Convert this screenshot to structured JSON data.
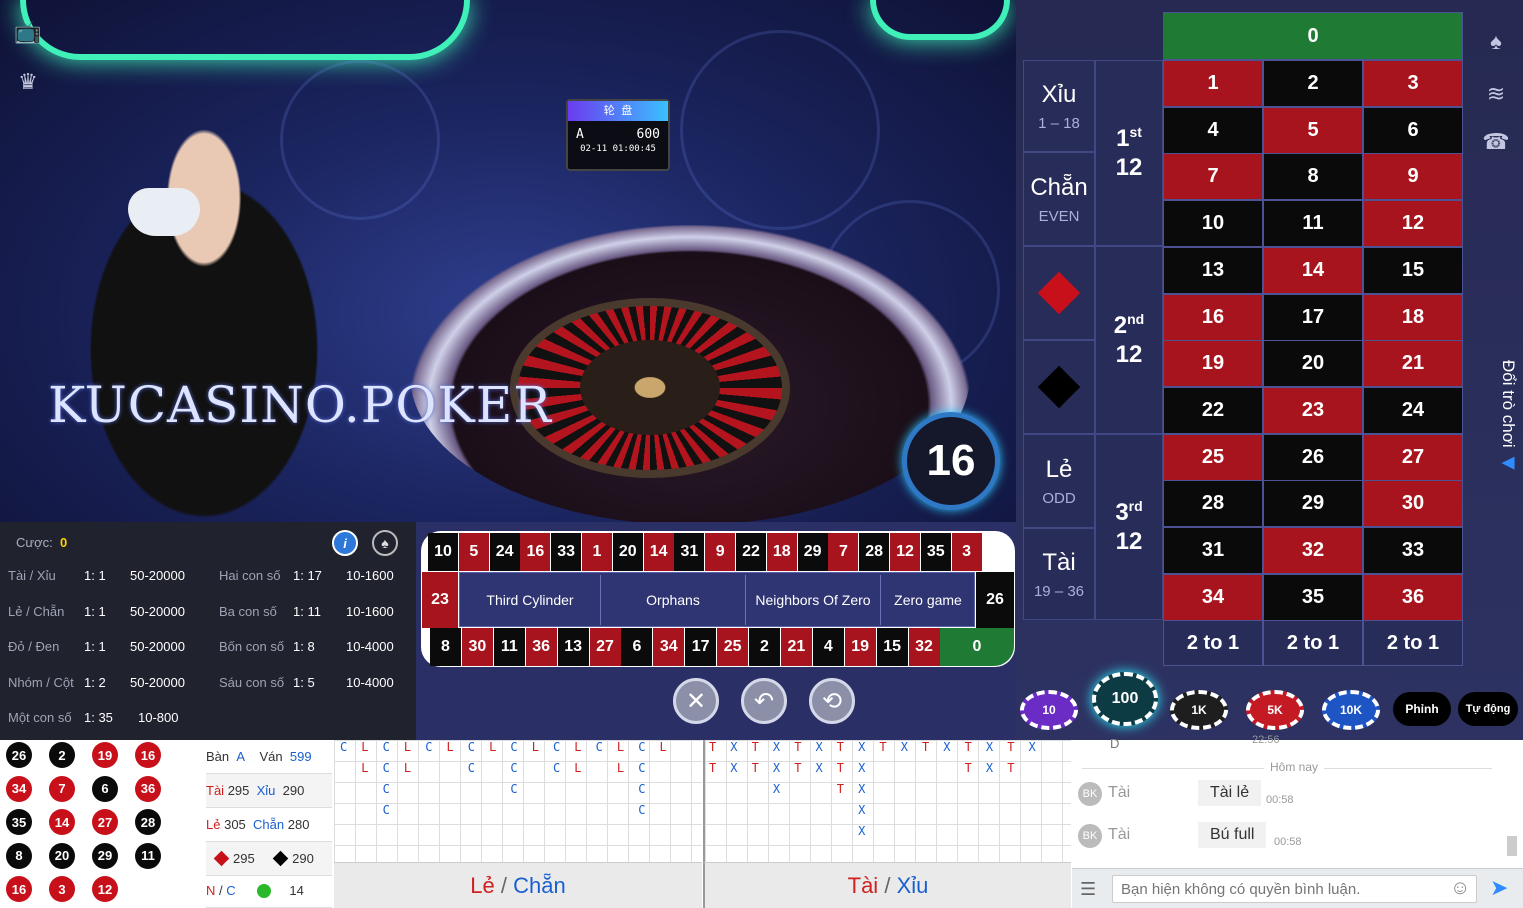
{
  "video": {
    "screen_symbols": "轮 盘",
    "screen_round": "A",
    "screen_value": "600",
    "screen_time": "02-11 01:00:45",
    "watermark": "KUCASINO.POKER",
    "result": "16",
    "left_icons": [
      "tv-icon",
      "crown-icon"
    ]
  },
  "board": {
    "zero": "0",
    "rows": [
      [
        {
          "n": "1",
          "c": "red"
        },
        {
          "n": "2",
          "c": "blk"
        },
        {
          "n": "3",
          "c": "red"
        }
      ],
      [
        {
          "n": "4",
          "c": "blk"
        },
        {
          "n": "5",
          "c": "red"
        },
        {
          "n": "6",
          "c": "blk"
        }
      ],
      [
        {
          "n": "7",
          "c": "red"
        },
        {
          "n": "8",
          "c": "blk"
        },
        {
          "n": "9",
          "c": "red"
        }
      ],
      [
        {
          "n": "10",
          "c": "blk"
        },
        {
          "n": "11",
          "c": "blk"
        },
        {
          "n": "12",
          "c": "red"
        }
      ],
      [
        {
          "n": "13",
          "c": "blk"
        },
        {
          "n": "14",
          "c": "red"
        },
        {
          "n": "15",
          "c": "blk"
        }
      ],
      [
        {
          "n": "16",
          "c": "red"
        },
        {
          "n": "17",
          "c": "blk"
        },
        {
          "n": "18",
          "c": "red"
        }
      ],
      [
        {
          "n": "19",
          "c": "red"
        },
        {
          "n": "20",
          "c": "blk"
        },
        {
          "n": "21",
          "c": "red"
        }
      ],
      [
        {
          "n": "22",
          "c": "blk"
        },
        {
          "n": "23",
          "c": "red"
        },
        {
          "n": "24",
          "c": "blk"
        }
      ],
      [
        {
          "n": "25",
          "c": "red"
        },
        {
          "n": "26",
          "c": "blk"
        },
        {
          "n": "27",
          "c": "red"
        }
      ],
      [
        {
          "n": "28",
          "c": "blk"
        },
        {
          "n": "29",
          "c": "blk"
        },
        {
          "n": "30",
          "c": "red"
        }
      ],
      [
        {
          "n": "31",
          "c": "blk"
        },
        {
          "n": "32",
          "c": "red"
        },
        {
          "n": "33",
          "c": "blk"
        }
      ],
      [
        {
          "n": "34",
          "c": "red"
        },
        {
          "n": "35",
          "c": "blk"
        },
        {
          "n": "36",
          "c": "red"
        }
      ]
    ],
    "col_bets": [
      "2 to 1",
      "2 to 1",
      "2 to 1"
    ],
    "xiu": "Xỉu",
    "xiu_range": "1 – 18",
    "chan": "Chẵn",
    "even": "EVEN",
    "le": "Lẻ",
    "odd": "ODD",
    "tai": "Tài",
    "tai_range": "19 – 36",
    "dozens": [
      {
        "ord": "1",
        "suf": "st",
        "n": "12"
      },
      {
        "ord": "2",
        "suf": "nd",
        "n": "12"
      },
      {
        "ord": "3",
        "suf": "rd",
        "n": "12"
      }
    ],
    "change_game": "Đổi trò chơi",
    "side_icons": [
      "spade-icon",
      "wifi-icon",
      "phone-icon"
    ]
  },
  "info": {
    "bet_label": "Cược:",
    "bet_value": "0",
    "left": [
      {
        "name": "Tài / Xỉu",
        "odds": "1: 1",
        "range": "50-20000"
      },
      {
        "name": "Lẻ / Chẵn",
        "odds": "1: 1",
        "range": "50-20000"
      },
      {
        "name": "Đỏ / Đen",
        "odds": "1: 1",
        "range": "50-20000"
      },
      {
        "name": "Nhóm / Cột",
        "odds": "1: 2",
        "range": "50-20000"
      },
      {
        "name": "Một con số",
        "odds": "1: 35",
        "range": "10-800"
      }
    ],
    "right": [
      {
        "name": "Hai con số",
        "odds": "1: 17",
        "range": "10-1600"
      },
      {
        "name": "Ba con số",
        "odds": "1: 11",
        "range": "10-1600"
      },
      {
        "name": "Bốn con số",
        "odds": "1: 8",
        "range": "10-4000"
      },
      {
        "name": "Sáu con số",
        "odds": "1: 5",
        "range": "10-4000"
      }
    ]
  },
  "race": {
    "top": [
      {
        "n": "10",
        "c": "blk"
      },
      {
        "n": "5",
        "c": "red"
      },
      {
        "n": "24",
        "c": "blk"
      },
      {
        "n": "16",
        "c": "red"
      },
      {
        "n": "33",
        "c": "blk"
      },
      {
        "n": "1",
        "c": "red"
      },
      {
        "n": "20",
        "c": "blk"
      },
      {
        "n": "14",
        "c": "red"
      },
      {
        "n": "31",
        "c": "blk"
      },
      {
        "n": "9",
        "c": "red"
      },
      {
        "n": "22",
        "c": "blk"
      },
      {
        "n": "18",
        "c": "red"
      },
      {
        "n": "29",
        "c": "blk"
      },
      {
        "n": "7",
        "c": "red"
      },
      {
        "n": "28",
        "c": "blk"
      },
      {
        "n": "12",
        "c": "red"
      },
      {
        "n": "35",
        "c": "blk"
      },
      {
        "n": "3",
        "c": "red"
      }
    ],
    "bottom": [
      {
        "n": "8",
        "c": "blk"
      },
      {
        "n": "30",
        "c": "red"
      },
      {
        "n": "11",
        "c": "blk"
      },
      {
        "n": "36",
        "c": "red"
      },
      {
        "n": "13",
        "c": "blk"
      },
      {
        "n": "27",
        "c": "red"
      },
      {
        "n": "6",
        "c": "blk"
      },
      {
        "n": "34",
        "c": "red"
      },
      {
        "n": "17",
        "c": "blk"
      },
      {
        "n": "25",
        "c": "red"
      },
      {
        "n": "2",
        "c": "blk"
      },
      {
        "n": "21",
        "c": "red"
      },
      {
        "n": "4",
        "c": "blk"
      },
      {
        "n": "19",
        "c": "red"
      },
      {
        "n": "15",
        "c": "blk"
      },
      {
        "n": "32",
        "c": "red"
      }
    ],
    "left_end": "23",
    "right_end": "26",
    "zero": "0",
    "sections": [
      "Third Cylinder",
      "Orphans",
      "Neighbors Of Zero",
      "Zero game"
    ]
  },
  "chips": [
    {
      "label": "10",
      "color": "#6a2cc4"
    },
    {
      "label": "100",
      "color": "#0d3b44"
    },
    {
      "label": "1K",
      "color": "#1e1e1e"
    },
    {
      "label": "5K",
      "color": "#c41a24"
    },
    {
      "label": "10K",
      "color": "#1d55c4"
    }
  ],
  "chip_buttons": [
    "Phỉnh",
    "Tự động"
  ],
  "history_balls": [
    {
      "n": "26",
      "c": "blk"
    },
    {
      "n": "2",
      "c": "blk"
    },
    {
      "n": "19",
      "c": "red"
    },
    {
      "n": "16",
      "c": "red"
    },
    {
      "n": "34",
      "c": "red"
    },
    {
      "n": "7",
      "c": "red"
    },
    {
      "n": "6",
      "c": "blk"
    },
    {
      "n": "36",
      "c": "red"
    },
    {
      "n": "35",
      "c": "blk"
    },
    {
      "n": "14",
      "c": "red"
    },
    {
      "n": "27",
      "c": "red"
    },
    {
      "n": "28",
      "c": "blk"
    },
    {
      "n": "8",
      "c": "blk"
    },
    {
      "n": "20",
      "c": "blk"
    },
    {
      "n": "29",
      "c": "blk"
    },
    {
      "n": "11",
      "c": "blk"
    },
    {
      "n": "16",
      "c": "red"
    },
    {
      "n": "3",
      "c": "red"
    },
    {
      "n": "12",
      "c": "red"
    }
  ],
  "stats": {
    "ban_label": "Bàn",
    "ban_value": "A",
    "van_label": "Ván",
    "van_value": "599",
    "tai_label": "Tài",
    "tai_value": "295",
    "xiu_label": "Xỉu",
    "xiu_value": "290",
    "le_label": "Lẻ",
    "le_value": "305",
    "chan_label": "Chẵn",
    "chan_value": "280",
    "red_value": "295",
    "black_value": "290",
    "n_label": "N",
    "c_label": "C",
    "nc_sep": "/",
    "green_value": "14"
  },
  "road1": {
    "rows": [
      [
        "C",
        "L",
        "C",
        "L",
        "C",
        "L",
        "C",
        "L",
        "C",
        "L",
        "C",
        "L",
        "C",
        "L",
        "C",
        "L"
      ],
      [
        "",
        "L",
        "C",
        "L",
        "",
        "",
        "C",
        "",
        "C",
        "",
        "C",
        "L",
        "",
        "L",
        "C",
        ""
      ],
      [
        "",
        "",
        "C",
        "",
        "",
        "",
        "",
        "",
        "C",
        "",
        "",
        "",
        "",
        "",
        "C",
        ""
      ],
      [
        "",
        "",
        "C",
        "",
        "",
        "",
        "",
        "",
        "",
        "",
        "",
        "",
        "",
        "",
        "C",
        ""
      ]
    ],
    "footer_a": "Lẻ",
    "sep": "/",
    "footer_b": "Chẵn"
  },
  "road2": {
    "rows": [
      [
        "T",
        "X",
        "T",
        "X",
        "T",
        "X",
        "T",
        "X",
        "T",
        "X",
        "T",
        "X",
        "T",
        "X",
        "T",
        "X"
      ],
      [
        "T",
        "X",
        "T",
        "X",
        "T",
        "X",
        "T",
        "X",
        "",
        "",
        "",
        "",
        "T",
        "X",
        "T",
        ""
      ],
      [
        "",
        "",
        "",
        "X",
        "",
        "",
        "T",
        "X",
        "",
        "",
        "",
        "",
        "",
        "",
        "",
        ""
      ],
      [
        "",
        "",
        "",
        "",
        "",
        "",
        "",
        "X",
        "",
        "",
        "",
        "",
        "",
        "",
        "",
        ""
      ],
      [
        "",
        "",
        "",
        "",
        "",
        "",
        "",
        "X",
        "",
        "",
        "",
        "",
        "",
        "",
        "",
        ""
      ]
    ],
    "footer_a": "Tài",
    "sep": "/",
    "footer_b": "Xỉu"
  },
  "chat": {
    "top_partial": "D",
    "top_time": "22:56",
    "day_label": "Hôm nay",
    "messages": [
      {
        "avatar": "BK",
        "name": "Tài",
        "text": "Tài lẻ",
        "time": "00:58"
      },
      {
        "avatar": "BK",
        "name": "Tài",
        "text": "Bú full",
        "time": "00:58"
      }
    ],
    "placeholder": "Bạn hiện không có quyền bình luận."
  }
}
